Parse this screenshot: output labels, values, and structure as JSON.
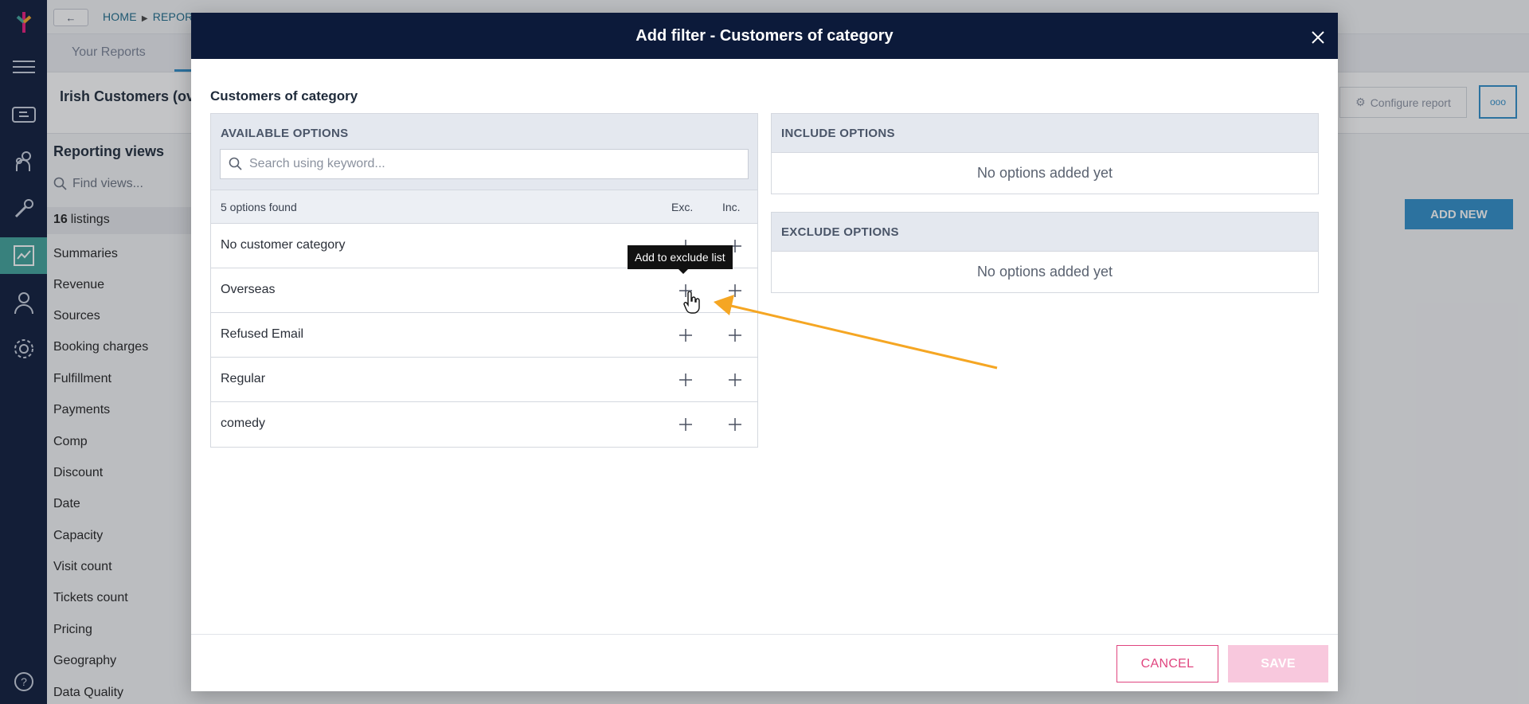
{
  "background": {
    "breadcrumb": [
      "HOME",
      "REPORT"
    ],
    "tab": "Your Reports",
    "report_title": "Irish Customers (ov",
    "configure_label": "Configure report",
    "more_label": "ooo",
    "add_new_label": "ADD NEW",
    "sidebar": {
      "heading": "Reporting views",
      "search_placeholder": "Find views...",
      "count_number": "16",
      "count_label": "listings",
      "items": [
        "Summaries",
        "Revenue",
        "Sources",
        "Booking charges",
        "Fulfillment",
        "Payments",
        "Comp",
        "Discount",
        "Date",
        "Capacity",
        "Visit count",
        "Tickets count",
        "Pricing",
        "Geography",
        "Data Quality"
      ]
    }
  },
  "modal": {
    "title": "Add filter - Customers of category",
    "section_title": "Customers of category",
    "available": {
      "heading": "AVAILABLE OPTIONS",
      "search_placeholder": "Search using keyword...",
      "found_label": "5 options found",
      "exc_header": "Exc.",
      "inc_header": "Inc.",
      "options": [
        "No customer category",
        "Overseas",
        "Refused Email",
        "Regular",
        "comedy"
      ]
    },
    "include": {
      "heading": "INCLUDE OPTIONS",
      "empty": "No options added yet"
    },
    "exclude": {
      "heading": "EXCLUDE OPTIONS",
      "empty": "No options added yet"
    },
    "tooltip": "Add to exclude list",
    "cancel_label": "CANCEL",
    "save_label": "SAVE"
  },
  "colors": {
    "navy": "#0c1a3a",
    "accent_blue": "#2f8ec9",
    "pink": "#e0457f",
    "annotation": "#f5a623"
  }
}
